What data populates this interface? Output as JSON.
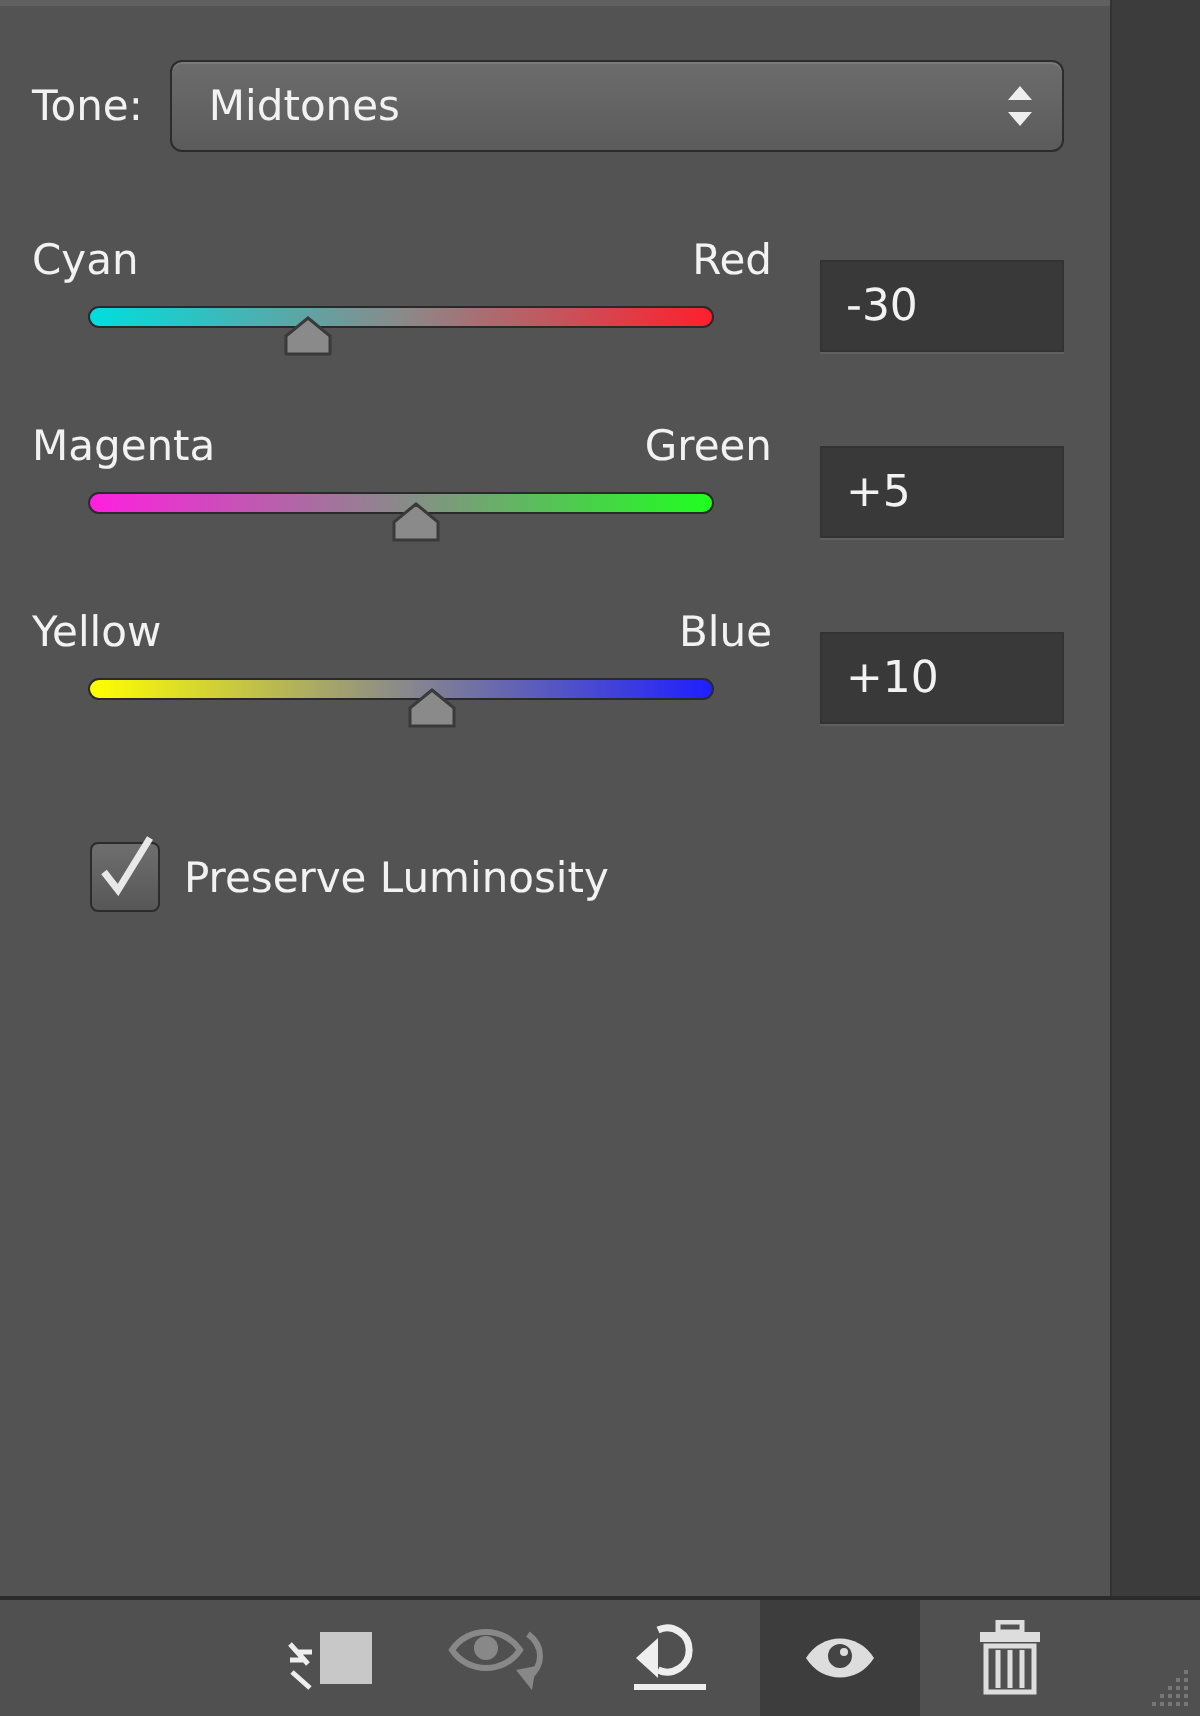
{
  "tone": {
    "label": "Tone:",
    "value": "Midtones"
  },
  "sliders": [
    {
      "kind": "cyan-red",
      "left": "Cyan",
      "right": "Red",
      "level": 0.35,
      "value": "-30"
    },
    {
      "kind": "magenta-green",
      "left": "Magenta",
      "right": "Green",
      "level": 0.525,
      "value": "+5"
    },
    {
      "kind": "yellow-blue",
      "left": "Yellow",
      "right": "Blue",
      "level": 0.55,
      "value": "+10"
    }
  ],
  "preserve_luminosity": {
    "label": "Preserve Luminosity",
    "checked": true
  },
  "toolbar": [
    {
      "kind": "clip",
      "selected": false,
      "disabled": false
    },
    {
      "kind": "view-previous",
      "selected": false,
      "disabled": true
    },
    {
      "kind": "reset",
      "selected": false,
      "disabled": false
    },
    {
      "kind": "visibility",
      "selected": true,
      "disabled": false
    },
    {
      "kind": "delete",
      "selected": false,
      "disabled": false
    }
  ]
}
